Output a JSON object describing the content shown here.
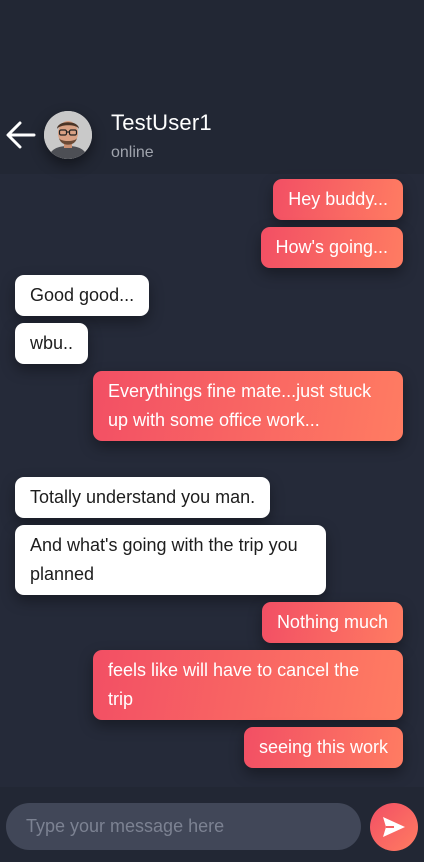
{
  "header": {
    "username": "TestUser1",
    "status": "online",
    "back_icon": "arrow-left-icon",
    "avatar_icon": "user-avatar"
  },
  "messages": [
    {
      "text": "Hey buddy...",
      "from": "me"
    },
    {
      "text": "How's going...",
      "from": "me"
    },
    {
      "text": "Good good...",
      "from": "other"
    },
    {
      "text": "wbu..",
      "from": "other"
    },
    {
      "text": "Everythings fine mate...just stuck up with some office work...",
      "from": "me"
    },
    {
      "text": "Totally understand you man.",
      "from": "other"
    },
    {
      "text": "And what's going with the trip you planned",
      "from": "other"
    },
    {
      "text": "Nothing much",
      "from": "me"
    },
    {
      "text": "feels like will have to cancel the trip",
      "from": "me"
    },
    {
      "text": "seeing this work",
      "from": "me"
    }
  ],
  "composer": {
    "placeholder": "Type your message here",
    "value": "",
    "send_icon": "send-icon"
  },
  "colors": {
    "background": "#252a39",
    "header": "#222734",
    "sent_start": "#f24f64",
    "sent_end": "#ff7c62",
    "received": "#ffffff",
    "input": "#414758"
  }
}
